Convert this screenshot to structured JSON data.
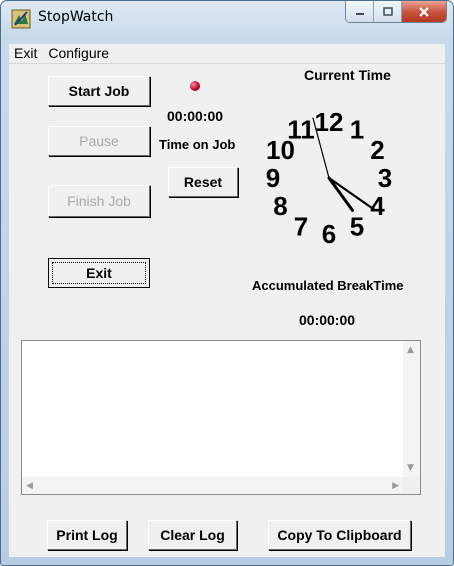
{
  "window": {
    "title": "StopWatch"
  },
  "menu": {
    "items": [
      "Exit",
      "Configure"
    ]
  },
  "buttons": {
    "start_job": "Start Job",
    "pause": "Pause",
    "finish_job": "Finish Job",
    "exit": "Exit",
    "reset": "Reset",
    "print_log": "Print Log",
    "clear_log": "Clear Log",
    "copy_clipboard": "Copy To Clipboard"
  },
  "job_timer": {
    "value": "00:00:00",
    "label": "Time on Job"
  },
  "clock": {
    "title": "Current Time",
    "numerals": [
      "12",
      "1",
      "2",
      "3",
      "4",
      "5",
      "6",
      "7",
      "8",
      "9",
      "10",
      "11"
    ],
    "hour_hand_angle_deg": 144,
    "minute_hand_angle_deg": 125,
    "second_hand_angle_deg": 345
  },
  "break_time": {
    "label": "Accumulated BreakTime",
    "value": "00:00:00"
  },
  "log": {
    "content": ""
  },
  "colors": {
    "indicator": "#b0002a",
    "face_bg": "#f0f0f0"
  }
}
